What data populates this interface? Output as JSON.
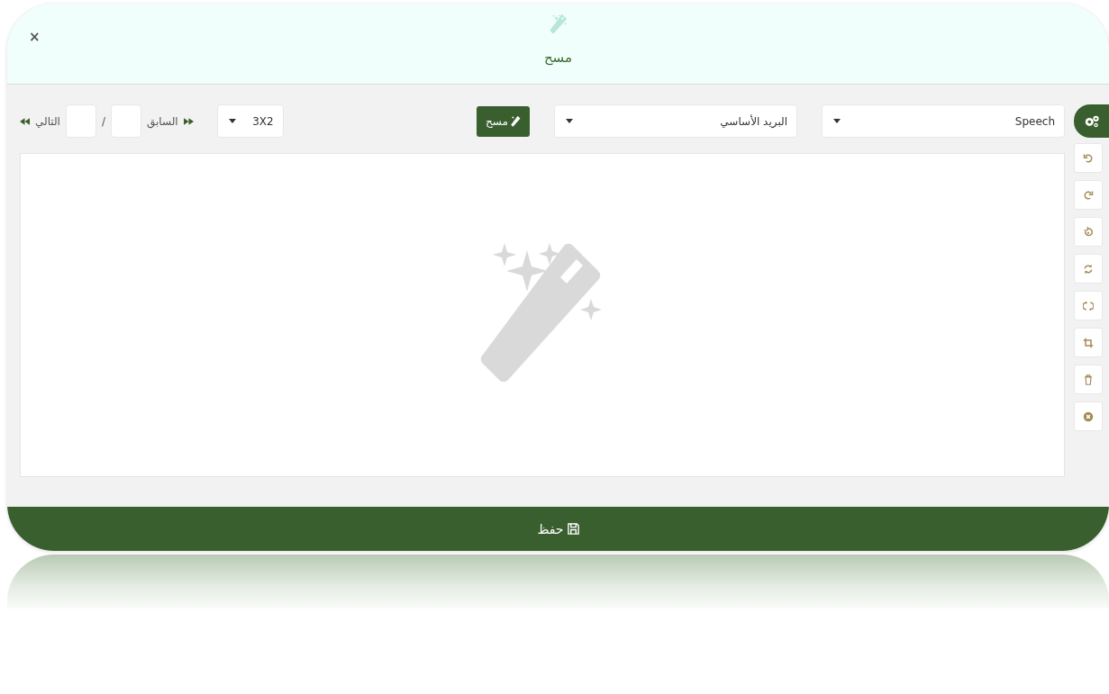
{
  "dialog": {
    "title": "مسح",
    "close": "×"
  },
  "toolbar": {
    "selects": [
      {
        "value": "Speech"
      },
      {
        "value": "البريد الأساسي"
      }
    ],
    "action_button": "مسح",
    "layout_select": {
      "value": "3X2"
    },
    "pager": {
      "previous": "السابق",
      "separator": "/",
      "next": "التالي"
    }
  },
  "side_tools": [
    {
      "kind": "undo"
    },
    {
      "kind": "redo"
    },
    {
      "kind": "rotate"
    },
    {
      "kind": "refresh"
    },
    {
      "kind": "sync"
    },
    {
      "kind": "crop"
    },
    {
      "kind": "delete"
    },
    {
      "kind": "cancel"
    }
  ],
  "footer": {
    "save": "حفظ"
  }
}
